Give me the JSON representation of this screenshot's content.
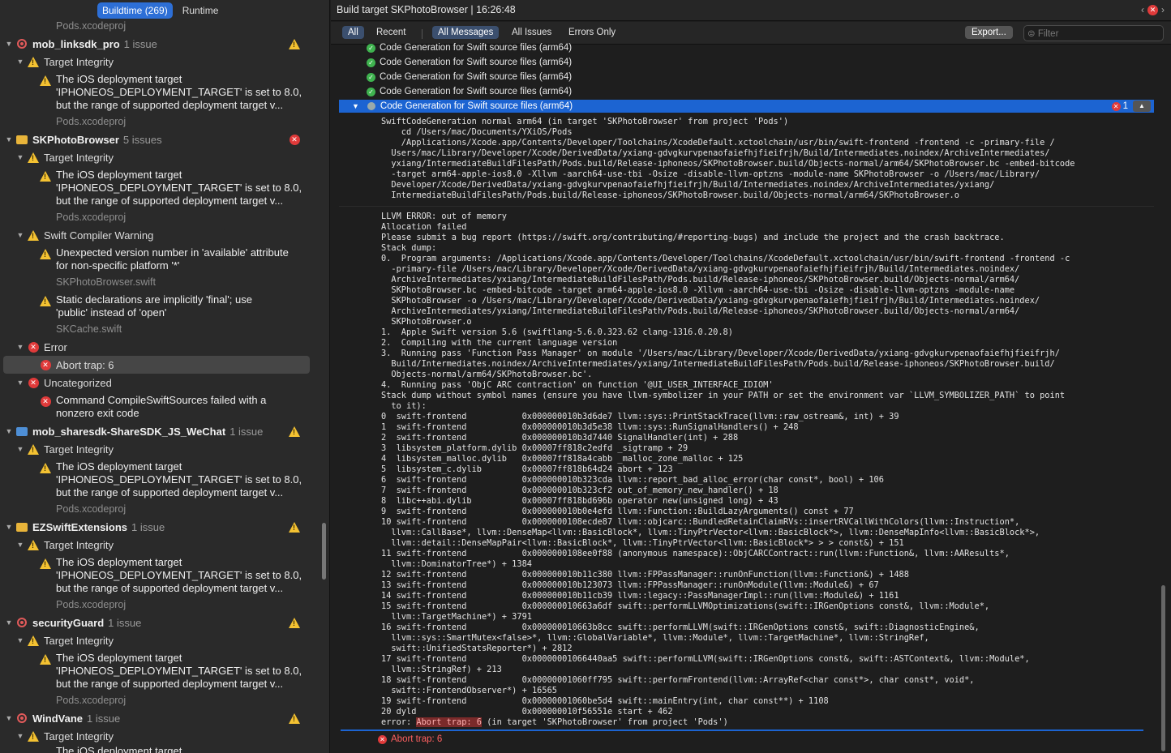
{
  "tabs": {
    "buildtime": "Buildtime (269)",
    "runtime": "Runtime"
  },
  "left": {
    "top_file": "Pods.xcodeproj",
    "groups": [
      {
        "name": "mob_linksdk_pro",
        "count": "1 issue"
      },
      {
        "name": "SKPhotoBrowser",
        "count": "5 issues"
      },
      {
        "name": "mob_sharesdk-ShareSDK_JS_WeChat",
        "count": "1 issue"
      },
      {
        "name": "EZSwiftExtensions",
        "count": "1 issue"
      },
      {
        "name": "securityGuard",
        "count": "1 issue"
      },
      {
        "name": "WindVane",
        "count": "1 issue"
      }
    ],
    "target_integrity": "Target Integrity",
    "deploy_msg_1": "The iOS deployment target",
    "deploy_msg_2": "'IPHONEOS_DEPLOYMENT_TARGET' is set to 8.0,",
    "deploy_msg_3": "but the range of supported deployment target v...",
    "pods_file": "Pods.xcodeproj",
    "swift_warning": "Swift Compiler Warning",
    "unexpected_1": "Unexpected version number in 'available' attribute",
    "unexpected_2": "for non-specific platform '*'",
    "skpb_file": "SKPhotoBrowser.swift",
    "static_1": "Static declarations are implicitly 'final'; use",
    "static_2": "'public' instead of 'open'",
    "skcache_file": "SKCache.swift",
    "error": "Error",
    "abort": "Abort trap: 6",
    "uncategorized": "Uncategorized",
    "cmd_1": "Command CompileSwiftSources failed with a",
    "cmd_2": "nonzero exit code",
    "cut_msg": "The iOS deployment target"
  },
  "header": {
    "title": "Build target SKPhotoBrowser | 16:26:48"
  },
  "filters": {
    "all": "All",
    "recent": "Recent",
    "all_messages": "All Messages",
    "all_issues": "All Issues",
    "errors_only": "Errors Only",
    "export": "Export...",
    "filter_placeholder": "Filter"
  },
  "codegen": "Code Generation for Swift source files (arm64)",
  "codegen_badge": "1",
  "cmd_text": "SwiftCodeGeneration normal arm64 (in target 'SKPhotoBrowser' from project 'Pods')\n    cd /Users/mac/Documents/YXiOS/Pods\n    /Applications/Xcode.app/Contents/Developer/Toolchains/XcodeDefault.xctoolchain/usr/bin/swift-frontend -frontend -c -primary-file /\n  Users/mac/Library/Developer/Xcode/DerivedData/yxiang-gdvgkurvpenaofaiefhjfieifrjh/Build/Intermediates.noindex/ArchiveIntermediates/\n  yxiang/IntermediateBuildFilesPath/Pods.build/Release-iphoneos/SKPhotoBrowser.build/Objects-normal/arm64/SKPhotoBrowser.bc -embed-bitcode\n  -target arm64-apple-ios8.0 -Xllvm -aarch64-use-tbi -Osize -disable-llvm-optzns -module-name SKPhotoBrowser -o /Users/mac/Library/\n  Developer/Xcode/DerivedData/yxiang-gdvgkurvpenaofaiefhjfieifrjh/Build/Intermediates.noindex/ArchiveIntermediates/yxiang/\n  IntermediateBuildFilesPath/Pods.build/Release-iphoneos/SKPhotoBrowser.build/Objects-normal/arm64/SKPhotoBrowser.o",
  "log_text": "LLVM ERROR: out of memory\nAllocation failed\nPlease submit a bug report (https://swift.org/contributing/#reporting-bugs) and include the project and the crash backtrace.\nStack dump:\n0.  Program arguments: /Applications/Xcode.app/Contents/Developer/Toolchains/XcodeDefault.xctoolchain/usr/bin/swift-frontend -frontend -c\n  -primary-file /Users/mac/Library/Developer/Xcode/DerivedData/yxiang-gdvgkurvpenaofaiefhjfieifrjh/Build/Intermediates.noindex/\n  ArchiveIntermediates/yxiang/IntermediateBuildFilesPath/Pods.build/Release-iphoneos/SKPhotoBrowser.build/Objects-normal/arm64/\n  SKPhotoBrowser.bc -embed-bitcode -target arm64-apple-ios8.0 -Xllvm -aarch64-use-tbi -Osize -disable-llvm-optzns -module-name\n  SKPhotoBrowser -o /Users/mac/Library/Developer/Xcode/DerivedData/yxiang-gdvgkurvpenaofaiefhjfieifrjh/Build/Intermediates.noindex/\n  ArchiveIntermediates/yxiang/IntermediateBuildFilesPath/Pods.build/Release-iphoneos/SKPhotoBrowser.build/Objects-normal/arm64/\n  SKPhotoBrowser.o\n1.  Apple Swift version 5.6 (swiftlang-5.6.0.323.62 clang-1316.0.20.8)\n2.  Compiling with the current language version\n3.  Running pass 'Function Pass Manager' on module '/Users/mac/Library/Developer/Xcode/DerivedData/yxiang-gdvgkurvpenaofaiefhjfieifrjh/\n  Build/Intermediates.noindex/ArchiveIntermediates/yxiang/IntermediateBuildFilesPath/Pods.build/Release-iphoneos/SKPhotoBrowser.build/\n  Objects-normal/arm64/SKPhotoBrowser.bc'.\n4.  Running pass 'ObjC ARC contraction' on function '@UI_USER_INTERFACE_IDIOM'\nStack dump without symbol names (ensure you have llvm-symbolizer in your PATH or set the environment var `LLVM_SYMBOLIZER_PATH` to point\n  to it):\n0  swift-frontend           0x000000010b3d6de7 llvm::sys::PrintStackTrace(llvm::raw_ostream&, int) + 39\n1  swift-frontend           0x000000010b3d5e38 llvm::sys::RunSignalHandlers() + 248\n2  swift-frontend           0x000000010b3d7440 SignalHandler(int) + 288\n3  libsystem_platform.dylib 0x00007ff818c2edfd _sigtramp + 29\n4  libsystem_malloc.dylib   0x00007ff818a4cabb _malloc_zone_malloc + 125\n5  libsystem_c.dylib        0x00007ff818b64d24 abort + 123\n6  swift-frontend           0x000000010b323cda llvm::report_bad_alloc_error(char const*, bool) + 106\n7  swift-frontend           0x000000010b323cf2 out_of_memory_new_handler() + 18\n8  libc++abi.dylib          0x00007ff818bd696b operator new(unsigned long) + 43\n9  swift-frontend           0x000000010b0e4efd llvm::Function::BuildLazyArguments() const + 77\n10 swift-frontend           0x0000000108ecde87 llvm::objcarc::BundledRetainClaimRVs::insertRVCallWithColors(llvm::Instruction*,\n  llvm::CallBase*, llvm::DenseMap<llvm::BasicBlock*, llvm::TinyPtrVector<llvm::BasicBlock*>, llvm::DenseMapInfo<llvm::BasicBlock*>,\n  llvm::detail::DenseMapPair<llvm::BasicBlock*, llvm::TinyPtrVector<llvm::BasicBlock*> > > const&) + 151\n11 swift-frontend           0x0000000108ee0f88 (anonymous namespace)::ObjCARCContract::run(llvm::Function&, llvm::AAResults*,\n  llvm::DominatorTree*) + 1384\n12 swift-frontend           0x000000010b11c380 llvm::FPPassManager::runOnFunction(llvm::Function&) + 1488\n13 swift-frontend           0x000000010b123073 llvm::FPPassManager::runOnModule(llvm::Module&) + 67\n14 swift-frontend           0x000000010b11cb39 llvm::legacy::PassManagerImpl::run(llvm::Module&) + 1161\n15 swift-frontend           0x000000010663a6df swift::performLLVMOptimizations(swift::IRGenOptions const&, llvm::Module*,\n  llvm::TargetMachine*) + 3791\n16 swift-frontend           0x000000010663b8cc swift::performLLVM(swift::IRGenOptions const&, swift::DiagnosticEngine&,\n  llvm::sys::SmartMutex<false>*, llvm::GlobalVariable*, llvm::Module*, llvm::TargetMachine*, llvm::StringRef,\n  swift::UnifiedStatsReporter*) + 2812\n17 swift-frontend           0x00000001066440aa5 swift::performLLVM(swift::IRGenOptions const&, swift::ASTContext&, llvm::Module*,\n  llvm::StringRef) + 213\n18 swift-frontend           0x00000001060ff795 swift::performFrontend(llvm::ArrayRef<char const*>, char const*, void*,\n  swift::FrontendObserver*) + 16565\n19 swift-frontend           0x00000001060be5d4 swift::mainEntry(int, char const**) + 1108\n20 dyld                     0x000000010f56551e start + 462",
  "error_prefix": "error: ",
  "error_hl": "Abort trap: 6",
  "error_suffix": " (in target 'SKPhotoBrowser' from project 'Pods')",
  "bottom_error": "Abort trap: 6"
}
